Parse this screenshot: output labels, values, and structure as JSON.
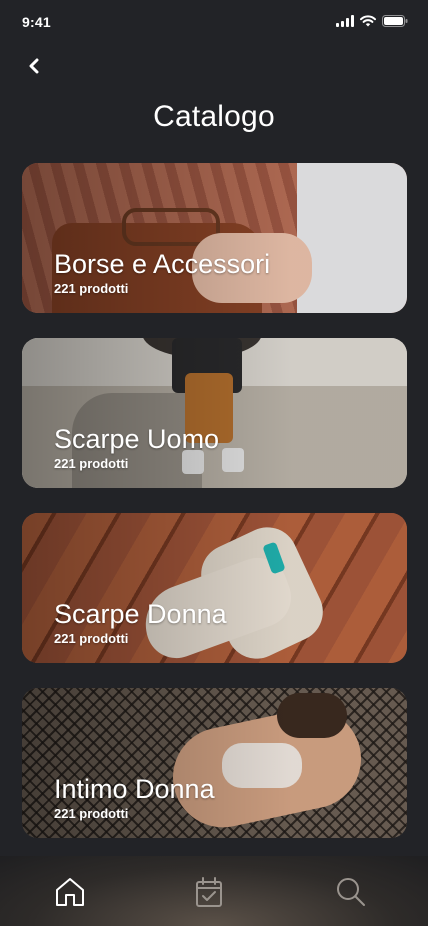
{
  "status_bar": {
    "time": "9:41"
  },
  "header": {
    "title": "Catalogo"
  },
  "categories": [
    {
      "title": "Borse e Accessori",
      "count": "221 prodotti"
    },
    {
      "title": "Scarpe Uomo",
      "count": "221 prodotti"
    },
    {
      "title": "Scarpe Donna",
      "count": "221 prodotti"
    },
    {
      "title": "Intimo Donna",
      "count": "221 prodotti"
    }
  ],
  "bottom_nav": {
    "items": [
      {
        "icon": "home-icon",
        "active": true
      },
      {
        "icon": "calendar-check-icon",
        "active": false
      },
      {
        "icon": "search-icon",
        "active": false
      }
    ]
  }
}
